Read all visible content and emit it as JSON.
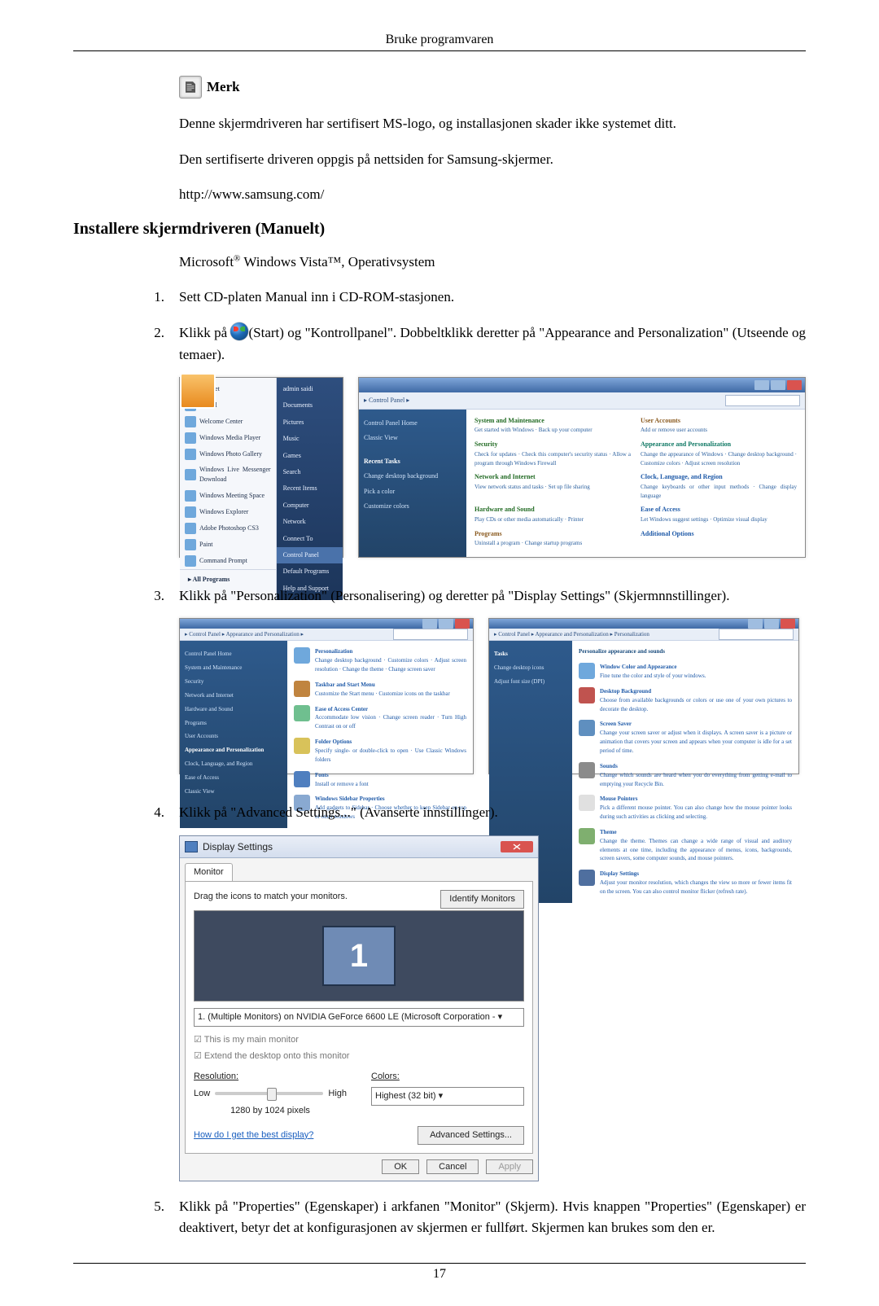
{
  "header": "Bruke programvaren",
  "note": {
    "label": "Merk",
    "p1": "Denne skjermdriveren har sertifisert MS-logo, og installasjonen skader ikke systemet ditt.",
    "p2": "Den sertifiserte driveren oppgis på nettsiden for Samsung-skjermer.",
    "p3": "http://www.samsung.com/"
  },
  "h2": "Installere skjermdriveren (Manuelt)",
  "osline_prefix": "Microsoft",
  "osline_mid": " Windows Vista™, Operativsystem",
  "steps": {
    "s1": "Sett CD-platen Manual inn i CD-ROM-stasjonen.",
    "s2a": "Klikk på ",
    "s2b": "(Start) og \"Kontrollpanel\". Dobbeltklikk deretter på \"Appearance and Personalization\" (Utseende og temaer).",
    "s3": "Klikk på \"Personalization\" (Personalisering) og deretter på \"Display Settings\" (Skjermnnstillinger).",
    "s4": "Klikk på \"Advanced Settings...\" (Avanserte innstillinger).",
    "s5": "Klikk på \"Properties\" (Egenskaper) i arkfanen \"Monitor\" (Skjerm). Hvis knappen \"Properties\" (Egenskaper) er deaktivert, betyr det at konfigurasjonen av skjermen er fullført. Skjermen kan brukes som den er."
  },
  "startmenu": {
    "items": [
      "Internet",
      "E-mail",
      "Welcome Center",
      "Windows Media Player",
      "Windows Photo Gallery",
      "Windows Live Messenger Download",
      "Windows Meeting Space",
      "Windows Explorer",
      "Adobe Photoshop CS3",
      "Paint",
      "Command Prompt"
    ],
    "all": "All Programs",
    "right": [
      "admin saidi",
      "Documents",
      "Pictures",
      "Music",
      "Games",
      "Search",
      "Recent Items",
      "Computer",
      "Network",
      "Connect To",
      "Control Panel",
      "Default Programs",
      "Help and Support"
    ]
  },
  "cpanel": {
    "crumb": "▸ Control Panel ▸",
    "side_top": [
      "Control Panel Home",
      "Classic View"
    ],
    "side_bottom_hdr": "Recent Tasks",
    "side_bottom": [
      "Change desktop background",
      "Pick a color",
      "Customize colors"
    ],
    "cats": [
      {
        "t": "System and Maintenance",
        "d": "Get started with Windows · Back up your computer"
      },
      {
        "t": "User Accounts",
        "d": "Add or remove user accounts"
      },
      {
        "t": "Security",
        "d": "Check for updates · Check this computer's security status · Allow a program through Windows Firewall"
      },
      {
        "t": "Appearance and Personalization",
        "d": "Change the appearance of Windows · Change desktop background · Customize colors · Adjust screen resolution"
      },
      {
        "t": "Network and Internet",
        "d": "View network status and tasks · Set up file sharing"
      },
      {
        "t": "Clock, Language, and Region",
        "d": "Change keyboards or other input methods · Change display language"
      },
      {
        "t": "Hardware and Sound",
        "d": "Play CDs or other media automatically · Printer"
      },
      {
        "t": "Ease of Access",
        "d": "Let Windows suggest settings · Optimize visual display"
      },
      {
        "t": "Programs",
        "d": "Uninstall a program · Change startup programs"
      },
      {
        "t": "Additional Options",
        "d": ""
      }
    ]
  },
  "step3a": {
    "crumb": "▸ Control Panel ▸ Appearance and Personalization ▸",
    "side": [
      "Control Panel Home",
      "System and Maintenance",
      "Security",
      "Network and Internet",
      "Hardware and Sound",
      "Programs",
      "User Accounts",
      "Appearance and Personalization",
      "Clock, Language, and Region",
      "Ease of Access",
      "Classic View"
    ],
    "items": [
      {
        "t": "Personalization",
        "d": "Change desktop background · Customize colors · Adjust screen resolution · Change the theme · Change screen saver"
      },
      {
        "t": "Taskbar and Start Menu",
        "d": "Customize the Start menu · Customize icons on the taskbar"
      },
      {
        "t": "Ease of Access Center",
        "d": "Accommodate low vision · Change screen reader · Turn High Contrast on or off"
      },
      {
        "t": "Folder Options",
        "d": "Specify single- or double-click to open · Use Classic Windows folders"
      },
      {
        "t": "Fonts",
        "d": "Install or remove a font"
      },
      {
        "t": "Windows Sidebar Properties",
        "d": "Add gadgets to Sidebar · Choose whether to keep Sidebar on top of other windows"
      }
    ]
  },
  "step3b": {
    "crumb": "▸ Control Panel ▸ Appearance and Personalization ▸ Personalization",
    "title": "Personalize appearance and sounds",
    "side": [
      "Tasks",
      "Change desktop icons",
      "Adjust font size (DPI)"
    ],
    "items": [
      {
        "t": "Window Color and Appearance",
        "d": "Fine tune the color and style of your windows."
      },
      {
        "t": "Desktop Background",
        "d": "Choose from available backgrounds or colors or use one of your own pictures to decorate the desktop."
      },
      {
        "t": "Screen Saver",
        "d": "Change your screen saver or adjust when it displays. A screen saver is a picture or animation that covers your screen and appears when your computer is idle for a set period of time."
      },
      {
        "t": "Sounds",
        "d": "Change which sounds are heard when you do everything from getting e-mail to emptying your Recycle Bin."
      },
      {
        "t": "Mouse Pointers",
        "d": "Pick a different mouse pointer. You can also change how the mouse pointer looks during such activities as clicking and selecting."
      },
      {
        "t": "Theme",
        "d": "Change the theme. Themes can change a wide range of visual and auditory elements at one time, including the appearance of menus, icons, backgrounds, screen savers, some computer sounds, and mouse pointers."
      },
      {
        "t": "Display Settings",
        "d": "Adjust your monitor resolution, which changes the view so more or fewer items fit on the screen. You can also control monitor flicker (refresh rate)."
      }
    ]
  },
  "display": {
    "title": "Display Settings",
    "tab": "Monitor",
    "hint": "Drag the icons to match your monitors.",
    "identify": "Identify Monitors",
    "mon": "1",
    "combo": "1. (Multiple Monitors) on NVIDIA GeForce 6600 LE (Microsoft Corporation - ▾",
    "chk1": "☑ This is my main monitor",
    "chk2": "☑ Extend the desktop onto this monitor",
    "res_label": "Resolution:",
    "low": "Low",
    "high": "High",
    "res_value": "1280 by 1024 pixels",
    "col_label": "Colors:",
    "col_value": "Highest (32 bit)   ▾",
    "help": "How do I get the best display?",
    "adv": "Advanced Settings...",
    "ok": "OK",
    "cancel": "Cancel",
    "apply": "Apply"
  },
  "page_number": "17"
}
